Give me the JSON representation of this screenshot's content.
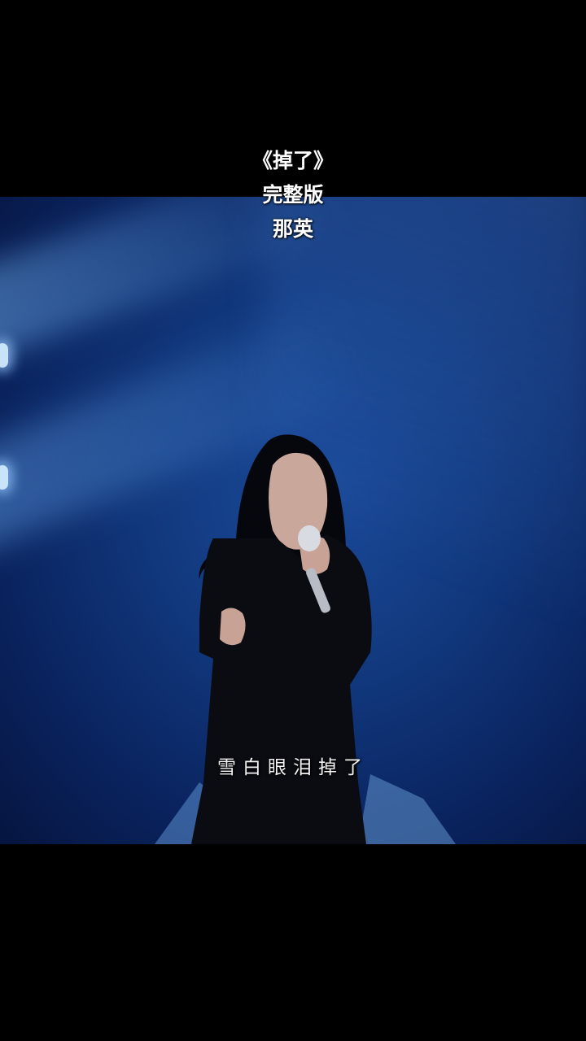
{
  "overlay": {
    "title_line_1": "《掉了》",
    "title_line_2": "完整版",
    "title_line_3": "那英"
  },
  "video": {
    "subtitle": "雪白眼泪掉了"
  },
  "colors": {
    "background": "#000000",
    "stage_blue": "#123a80",
    "text": "#ffffff"
  }
}
